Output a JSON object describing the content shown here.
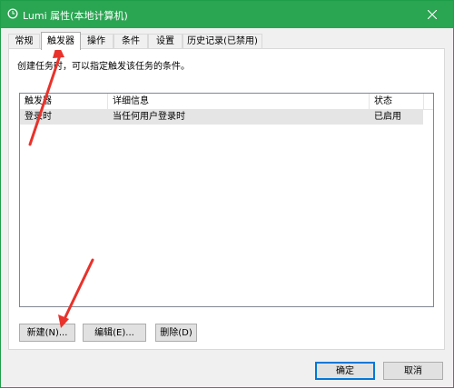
{
  "window": {
    "title": "Lumi 属性(本地计算机)",
    "accent": "#2aa552"
  },
  "tabs": [
    {
      "label": "常规",
      "active": false
    },
    {
      "label": "触发器",
      "active": true
    },
    {
      "label": "操作",
      "active": false
    },
    {
      "label": "条件",
      "active": false
    },
    {
      "label": "设置",
      "active": false
    },
    {
      "label": "历史记录(已禁用)",
      "active": false
    }
  ],
  "panel": {
    "description": "创建任务时，可以指定触发该任务的条件。",
    "columns": [
      "触发器",
      "详细信息",
      "状态"
    ],
    "rows": [
      {
        "trigger": "登录时",
        "details": "当任何用户登录时",
        "status": "已启用"
      }
    ]
  },
  "buttons": {
    "new": "新建(N)...",
    "edit": "编辑(E)...",
    "delete": "删除(D)",
    "ok": "确定",
    "cancel": "取消"
  },
  "annotation_color": "#e8322b"
}
